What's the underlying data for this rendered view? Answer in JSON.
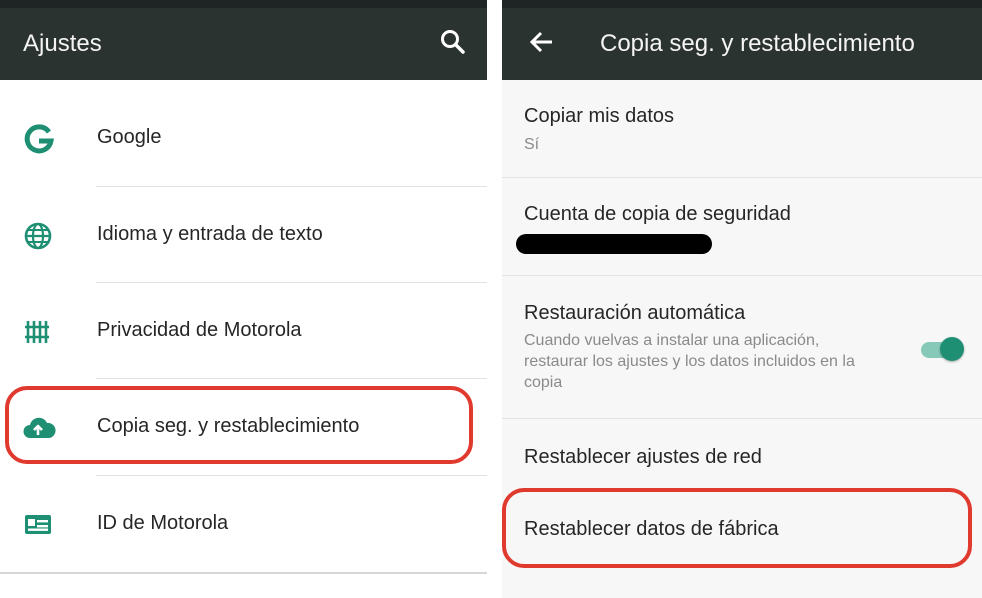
{
  "left": {
    "title": "Ajustes",
    "items": [
      {
        "label": "Google",
        "icon": "google-icon"
      },
      {
        "label": "Idioma y entrada de texto",
        "icon": "globe-icon"
      },
      {
        "label": "Privacidad de Motorola",
        "icon": "privacy-grid-icon"
      },
      {
        "label": "Copia seg. y restablecimiento",
        "icon": "cloud-upload-icon",
        "highlighted": true
      },
      {
        "label": "ID de Motorola",
        "icon": "id-card-icon"
      }
    ]
  },
  "right": {
    "title": "Copia seg. y restablecimiento",
    "items": [
      {
        "title": "Copiar mis datos",
        "summary": "Sí"
      },
      {
        "title": "Cuenta de copia de seguridad",
        "summary_redacted": true
      },
      {
        "title": "Restauración automática",
        "summary": "Cuando vuelvas a instalar una aplicación, restaurar los ajustes y los datos incluidos en la copia",
        "toggle_on": true
      },
      {
        "title": "Restablecer ajustes de red"
      },
      {
        "title": "Restablecer datos de fábrica",
        "highlighted": true
      }
    ]
  },
  "colors": {
    "appbar": "#2b3331",
    "accent": "#1e8f73",
    "highlight": "#e0392e"
  }
}
